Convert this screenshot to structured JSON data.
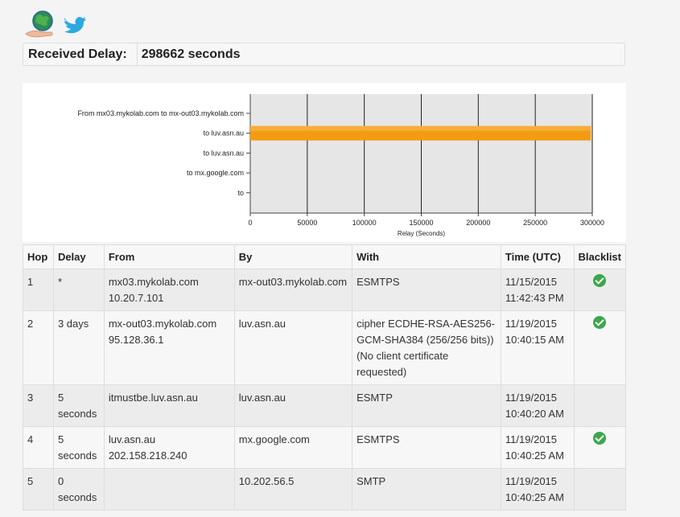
{
  "header": {
    "icons": [
      "globe-hand-icon",
      "twitter-bird-icon"
    ],
    "colors": {
      "globe": "#2e8b57",
      "twitter": "#2ba9e1"
    }
  },
  "summary": {
    "label": "Received Delay:",
    "value": "298662 seconds"
  },
  "chart_data": {
    "type": "bar",
    "orientation": "horizontal",
    "categories": [
      "From mx03.mykolab.com to mx-out03.mykolab.com",
      "to luv.asn.au",
      "to luv.asn.au",
      "to mx.google.com",
      "to"
    ],
    "values": [
      0,
      298662,
      0,
      0,
      0
    ],
    "xlabel": "Relay (Seconds)",
    "xlim": [
      0,
      300000
    ],
    "xticks": [
      "0",
      "50000",
      "100000",
      "150000",
      "200000",
      "250000",
      "300000"
    ],
    "grid": true,
    "bar_color": "#f39c12"
  },
  "table": {
    "headers": [
      "Hop",
      "Delay",
      "From",
      "By",
      "With",
      "Time (UTC)",
      "Blacklist"
    ],
    "rows": [
      {
        "hop": "1",
        "delay": "*",
        "from": [
          "mx03.mykolab.com",
          "10.20.7.101"
        ],
        "by": "mx-out03.mykolab.com",
        "with": "ESMTPS",
        "time": [
          "11/15/2015",
          "11:42:43 PM"
        ],
        "blacklist": true
      },
      {
        "hop": "2",
        "delay": "3 days",
        "from": [
          "mx-out03.mykolab.com",
          "95.128.36.1"
        ],
        "by": "luv.asn.au",
        "with": "cipher ECDHE-RSA-AES256-GCM-SHA384 (256/256 bits)) (No client certificate requested)",
        "time": [
          "11/19/2015",
          "10:40:15 AM"
        ],
        "blacklist": true
      },
      {
        "hop": "3",
        "delay": "5 seconds",
        "from": [
          "itmustbe.luv.asn.au"
        ],
        "by": "luv.asn.au",
        "with": "ESMTP",
        "time": [
          "11/19/2015",
          "10:40:20 AM"
        ],
        "blacklist": false
      },
      {
        "hop": "4",
        "delay": "5 seconds",
        "from": [
          "luv.asn.au",
          "202.158.218.240"
        ],
        "by": "mx.google.com",
        "with": "ESMTPS",
        "time": [
          "11/19/2015",
          "10:40:25 AM"
        ],
        "blacklist": true
      },
      {
        "hop": "5",
        "delay": "0 seconds",
        "from": [],
        "by": "10.202.56.5",
        "with": "SMTP",
        "time": [
          "11/19/2015",
          "10:40:25 AM"
        ],
        "blacklist": false
      }
    ]
  }
}
